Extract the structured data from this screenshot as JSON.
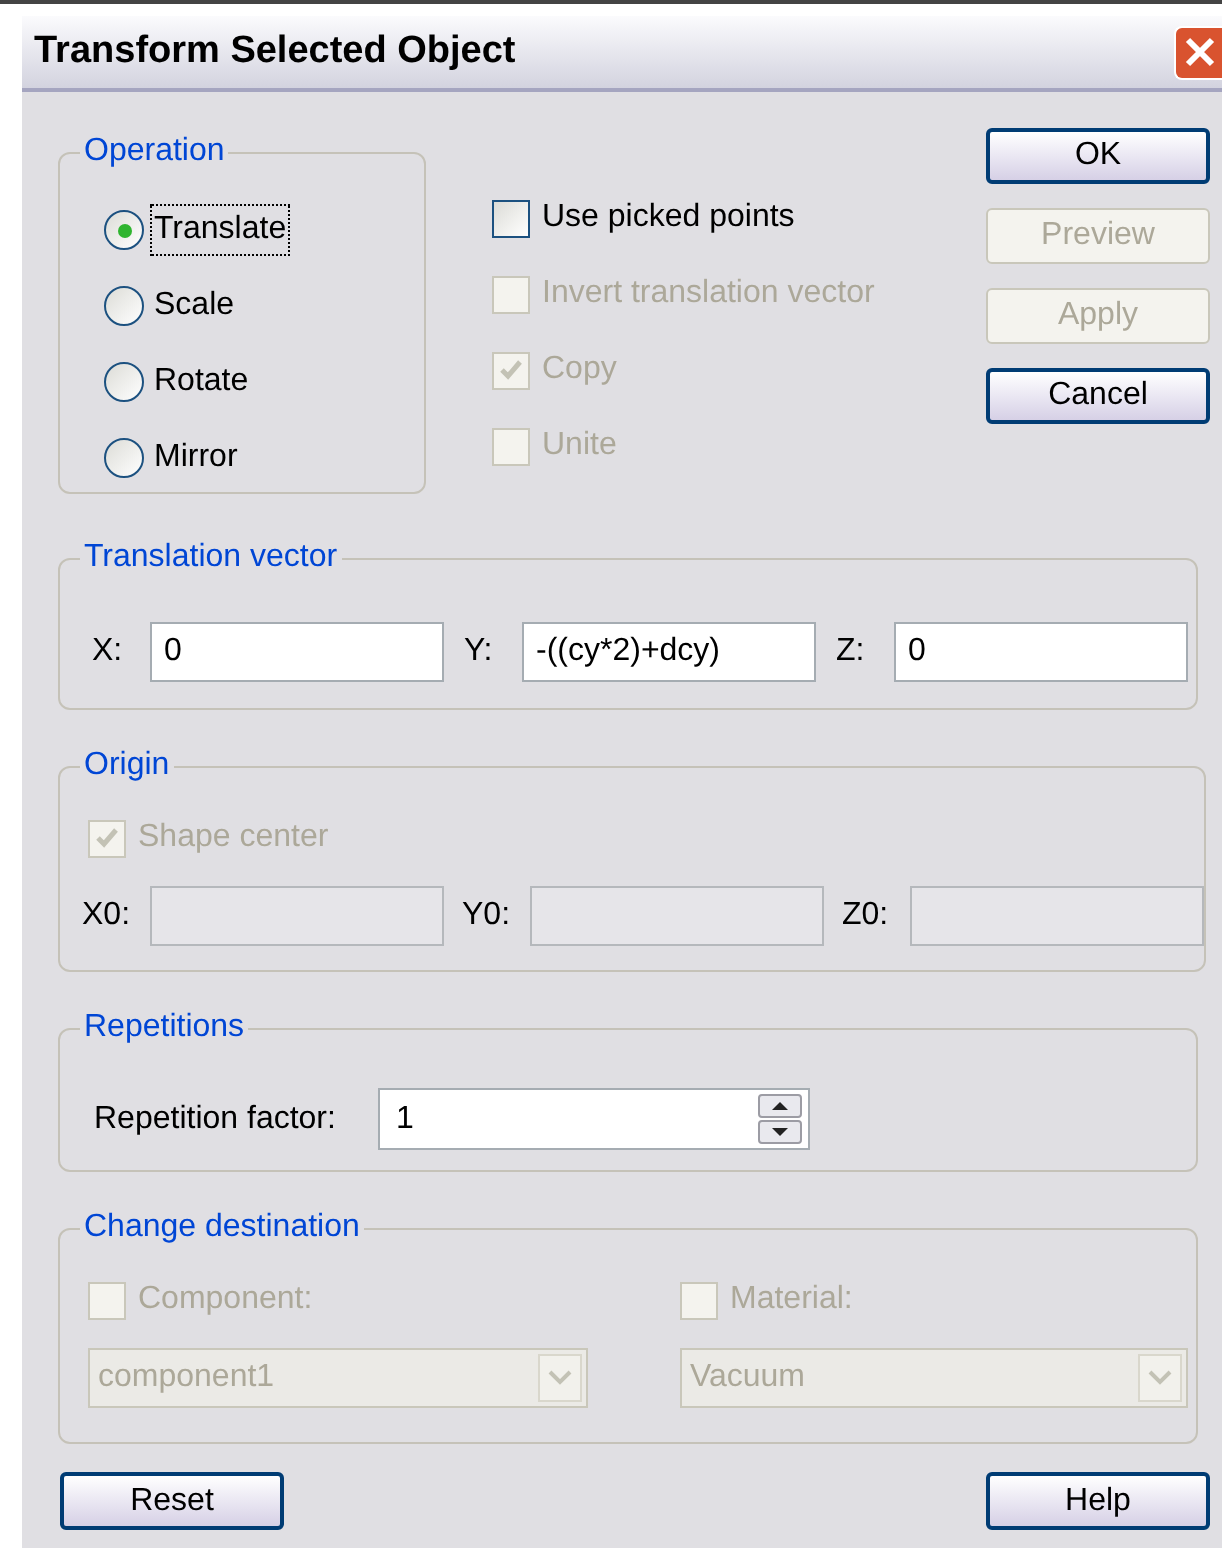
{
  "window": {
    "title": "Transform Selected Object"
  },
  "operation": {
    "legend": "Operation",
    "options": [
      {
        "label": "Translate",
        "selected": true
      },
      {
        "label": "Scale",
        "selected": false
      },
      {
        "label": "Rotate",
        "selected": false
      },
      {
        "label": "Mirror",
        "selected": false
      }
    ]
  },
  "options": [
    {
      "label": "Use picked points",
      "checked": false,
      "disabled": false
    },
    {
      "label": "Invert translation vector",
      "checked": false,
      "disabled": true
    },
    {
      "label": "Copy",
      "checked": true,
      "disabled": true
    },
    {
      "label": "Unite",
      "checked": false,
      "disabled": true
    }
  ],
  "buttons": [
    {
      "label": "OK",
      "disabled": false
    },
    {
      "label": "Preview",
      "disabled": true
    },
    {
      "label": "Apply",
      "disabled": true
    },
    {
      "label": "Cancel",
      "disabled": false
    }
  ],
  "translation_vector": {
    "legend": "Translation vector",
    "fields": [
      {
        "label": "X:",
        "value": "0"
      },
      {
        "label": "Y:",
        "value": "-((cy*2)+dcy)"
      },
      {
        "label": "Z:",
        "value": "0"
      }
    ]
  },
  "origin": {
    "legend": "Origin",
    "shape_center": {
      "label": "Shape center",
      "checked": true,
      "disabled": true
    },
    "fields": [
      {
        "label": "X0:",
        "disabled": true
      },
      {
        "label": "Y0:",
        "disabled": true
      },
      {
        "label": "Z0:",
        "disabled": true
      }
    ]
  },
  "repetitions": {
    "legend": "Repetitions",
    "label": "Repetition factor:",
    "value": "1"
  },
  "change_destination": {
    "legend": "Change destination",
    "items": [
      {
        "label": "Component:",
        "checked": false,
        "disabled": true,
        "value": "component1"
      },
      {
        "label": "Material:",
        "checked": false,
        "disabled": true,
        "value": "Vacuum"
      }
    ]
  },
  "footer_buttons": [
    {
      "label": "Reset"
    },
    {
      "label": "Help"
    }
  ]
}
